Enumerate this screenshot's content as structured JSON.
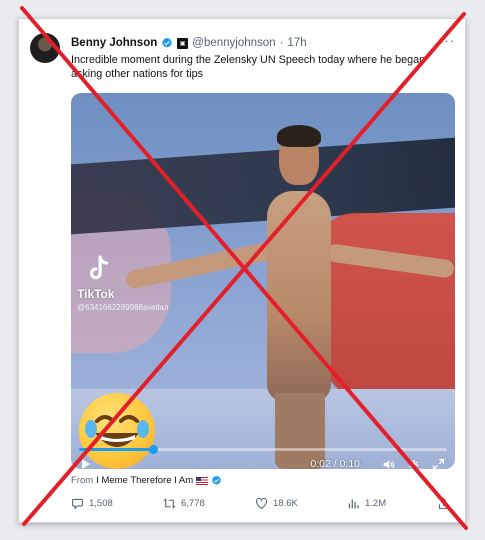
{
  "tweet": {
    "author_name": "Benny Johnson",
    "handle": "@bennyjohnson",
    "time": "17h",
    "more": "···",
    "text": "Incredible moment during the Zelensky UN Speech today where he began asking other nations for tips",
    "verified_color": "#1d9bf0"
  },
  "media": {
    "watermark_brand": "TikTok",
    "watermark_id": "@6341662289988svetlaл",
    "video_time": "0:02 / 0:10",
    "progress": 0.2,
    "accent": "#1d9bf0"
  },
  "source": {
    "prefix": "From",
    "name": "I Meme Therefore I Am"
  },
  "actions": {
    "replies": "1,508",
    "reposts": "6,778",
    "likes": "18.6K",
    "views": "1.2M"
  },
  "overlay": {
    "cross_color": "#e3202a"
  },
  "icons": [
    "verified-badge-icon",
    "square-badge-icon",
    "tiktok-logo-icon",
    "laughing-emoji-icon",
    "play-icon",
    "volume-icon",
    "settings-icon",
    "fullscreen-icon",
    "reply-icon",
    "repost-icon",
    "like-icon",
    "views-icon",
    "share-icon",
    "us-flag-icon"
  ]
}
